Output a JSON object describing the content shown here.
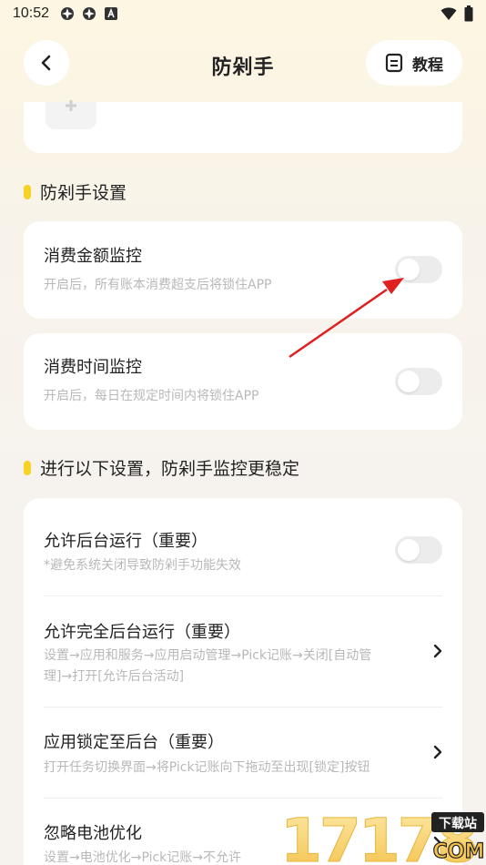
{
  "status_bar": {
    "time": "10:52",
    "left_icons": [
      "app-notification-icon",
      "app-notification-icon",
      "text-a-icon"
    ],
    "right_icons": [
      "wifi-icon",
      "battery-icon"
    ]
  },
  "header": {
    "title": "防剁手",
    "tutorial_label": "教程"
  },
  "sections": {
    "anti_spend_title": "防剁手设置",
    "stability_title": "进行以下设置，防剁手监控更稳定"
  },
  "amount_monitor": {
    "title": "消费金额监控",
    "desc": "开启后，所有账本消费超支后将锁住APP",
    "enabled": false
  },
  "time_monitor": {
    "title": "消费时间监控",
    "desc": "开启后，每日在规定时间内将锁住APP",
    "enabled": false
  },
  "stability_items": [
    {
      "title": "允许后台运行（重要）",
      "desc": "*避免系统关闭导致防剁手功能失效",
      "control": "toggle",
      "enabled": false
    },
    {
      "title": "允许完全后台运行（重要）",
      "desc_line1": "设置→应用和服务→应用启动管理→Pick记账→关闭[自动管",
      "desc_line2": "理]→打开[允许后台活动]",
      "control": "chevron"
    },
    {
      "title": "应用锁定至后台（重要）",
      "desc": "打开任务切换界面→将Pick记账向下拖动至出现[锁定]按钮",
      "control": "chevron"
    },
    {
      "title": "忽略电池优化",
      "desc": "设置→电池优化→Pick记账→不允许",
      "control": "chevron"
    }
  ],
  "watermark": {
    "text": "17178",
    "badge": "下载站",
    "suffix": "COM"
  },
  "colors": {
    "accent_yellow": "#f6d227",
    "toggle_off": "#ececec",
    "annotation_red": "#e02020"
  }
}
